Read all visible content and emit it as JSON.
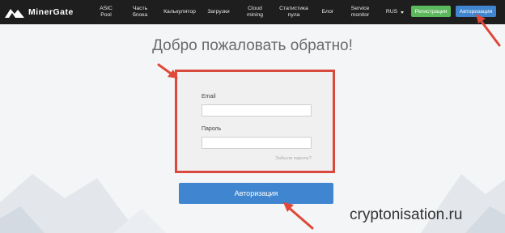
{
  "nav": {
    "logo_text": "MinerGate",
    "items": [
      {
        "label": "ASIC Pool"
      },
      {
        "label": "Часть блока"
      },
      {
        "label": "Калькулятор"
      },
      {
        "label": "Загрузки"
      },
      {
        "label": "Cloud mining"
      },
      {
        "label": "Статистика пула"
      },
      {
        "label": "Блог"
      },
      {
        "label": "Service monitor"
      }
    ],
    "language": "RUS",
    "register_label": "Регистрация",
    "login_label": "Авторизация"
  },
  "main": {
    "title": "Добро пожаловать обратно!",
    "email_label": "Email",
    "email_value": "",
    "password_label": "Пароль",
    "password_value": "",
    "forgot_label": "Забыли пароль?",
    "submit_label": "Авторизация"
  },
  "watermark": "cryptonisation.ru",
  "colors": {
    "nav_bg": "#1e1e1e",
    "register_green": "#5cb85c",
    "login_blue": "#3f85cf",
    "highlight_red": "#d9493d"
  }
}
